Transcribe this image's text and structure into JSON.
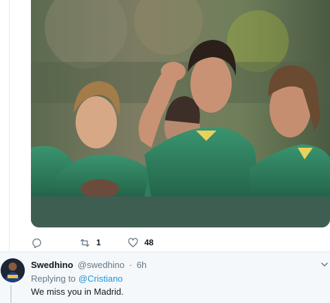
{
  "tweet": {
    "photo_alt": "Players in green jerseys, one saluting",
    "actions": {
      "reply_count": "",
      "retweet_count": "1",
      "like_count": "48"
    }
  },
  "reply": {
    "display_name": "Swedhino",
    "handle": "@swedhino",
    "separator": "·",
    "time": "6h",
    "replying_prefix": "Replying to",
    "replying_mention": "@Cristiano",
    "text": "We miss you in Madrid."
  },
  "colors": {
    "accent": "#1b95e0",
    "muted": "#657786",
    "jersey_green": "#2f7d5c",
    "card_footer": "#3f5e52"
  },
  "icons": [
    "reply-icon",
    "retweet-icon",
    "like-icon",
    "chevron-down-icon"
  ]
}
